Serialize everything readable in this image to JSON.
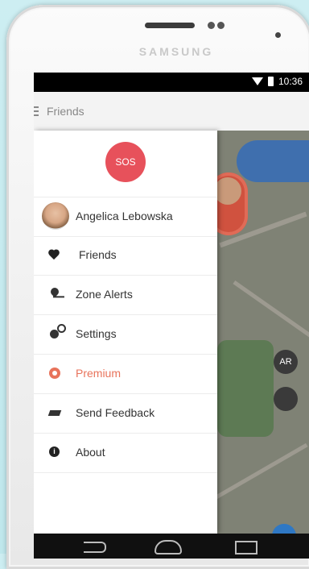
{
  "device": {
    "brand": "SAMSUNG"
  },
  "status_bar": {
    "time": "10:36",
    "wifi_icon": "wifi-icon",
    "battery_icon": "battery-icon"
  },
  "app_bar": {
    "title": "Friends",
    "menu_icon": "menu-icon"
  },
  "drawer": {
    "sos_label": "SOS",
    "profile": {
      "name": "Angelica Lebowska"
    },
    "items": [
      {
        "label": "Friends",
        "icon": "heart-icon"
      },
      {
        "label": "Zone Alerts",
        "icon": "pin-icon"
      },
      {
        "label": "Settings",
        "icon": "gear-icon"
      },
      {
        "label": "Premium",
        "icon": "premium-icon",
        "color": "#e8735b"
      },
      {
        "label": "Send Feedback",
        "icon": "feedback-icon"
      },
      {
        "label": "About",
        "icon": "info-icon"
      }
    ]
  },
  "map": {
    "chip_ar_label": "AR"
  },
  "colors": {
    "sos": "#e7515b",
    "premium": "#e8735b",
    "background": "#cdeef2"
  }
}
